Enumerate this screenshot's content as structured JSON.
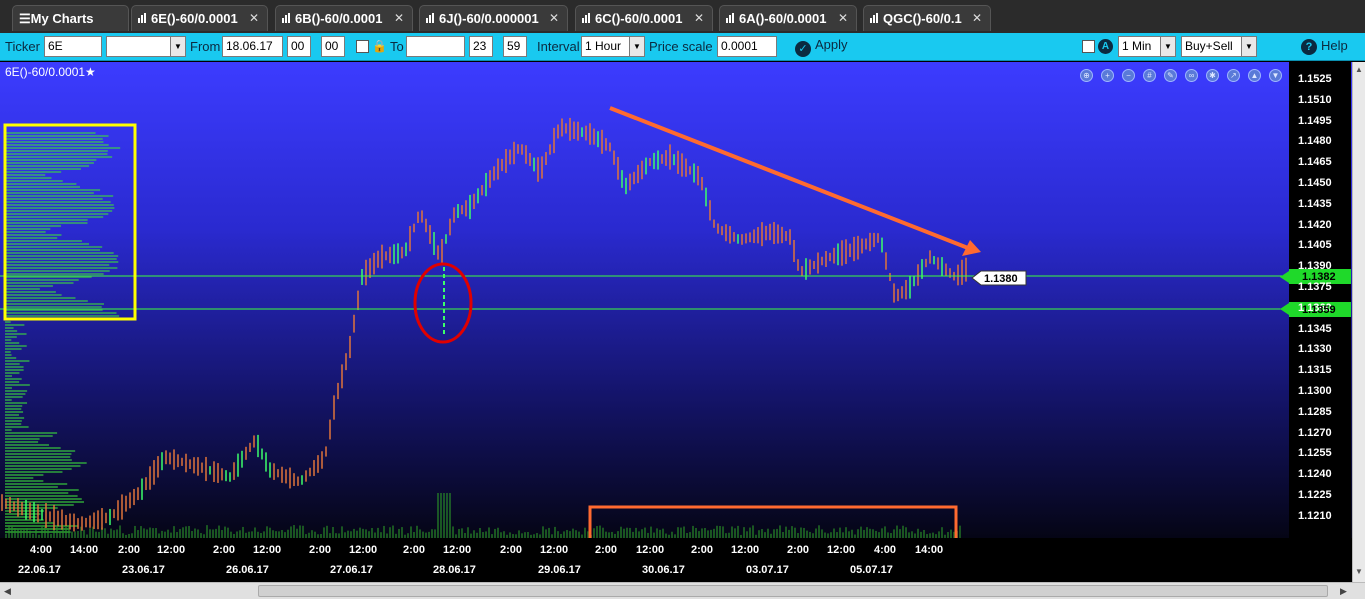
{
  "tabs": [
    {
      "label": "My Charts",
      "kind": "menu"
    },
    {
      "label": "6E()-60/0.0001",
      "close": "✕"
    },
    {
      "label": "6B()-60/0.0001",
      "close": "✕"
    },
    {
      "label": "6J()-60/0.000001",
      "close": "✕"
    },
    {
      "label": "6C()-60/0.0001",
      "close": "✕"
    },
    {
      "label": "6A()-60/0.0001",
      "close": "✕"
    },
    {
      "label": "QGC()-60/0.1",
      "close": "✕"
    }
  ],
  "toolbar": {
    "ticker_label": "Ticker",
    "ticker_value": "6E",
    "from_label": "From",
    "from_date": "18.06.17",
    "from_hour": "00",
    "from_min": "00",
    "to_label": "To",
    "to_date": "",
    "to_hour": "23",
    "to_min": "59",
    "interval_label": "Interval",
    "interval_value": "1 Hour",
    "price_scale_label": "Price scale",
    "price_scale_value": "0.0001",
    "apply_label": "Apply",
    "timeframe_value": "1 Min",
    "side_value": "Buy+Sell",
    "help_label": "Help"
  },
  "chart": {
    "title": "6E()-60/0.0001★",
    "current_price_label": "1.1380",
    "level_labels": [
      "1.1382",
      "1.1359"
    ],
    "y_ticks": [
      "1.1525",
      "1.1510",
      "1.1495",
      "1.1480",
      "1.1465",
      "1.1450",
      "1.1435",
      "1.1420",
      "1.1405",
      "1.1390",
      "1.1375",
      "1.1360",
      "1.1345",
      "1.1330",
      "1.1315",
      "1.1300",
      "1.1285",
      "1.1270",
      "1.1255",
      "1.1240",
      "1.1225",
      "1.1210"
    ],
    "x_time_ticks": [
      "4:00",
      "14:00",
      "2:00",
      "12:00",
      "2:00",
      "12:00",
      "2:00",
      "12:00",
      "2:00",
      "12:00",
      "2:00",
      "12:00",
      "2:00",
      "12:00",
      "2:00",
      "12:00",
      "2:00",
      "12:00",
      "4:00",
      "14:00"
    ],
    "x_date_ticks": [
      "22.06.17",
      "23.06.17",
      "26.06.17",
      "27.06.17",
      "28.06.17",
      "29.06.17",
      "30.06.17",
      "03.07.17",
      "05.07.17"
    ],
    "colors": {
      "level_line": "#3cff3c",
      "bar_down": "#e0743a",
      "bar_up": "#3cff6a",
      "trend_arrow": "#ff6a30",
      "highlight_box_profile": "#ffff00",
      "highlight_circle": "#e00000",
      "highlight_box_volume": "#ff6a30"
    }
  }
}
